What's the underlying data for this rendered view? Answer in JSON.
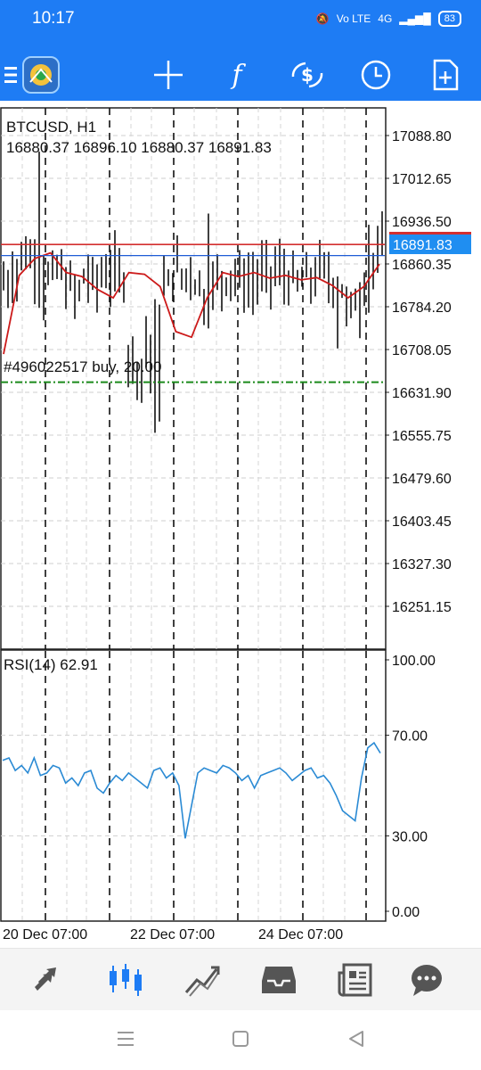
{
  "status": {
    "time": "10:17",
    "network": "Vo LTE",
    "signal": "4G",
    "battery": "83"
  },
  "toolbar": {
    "items": [
      {
        "icon": "menu-icon"
      },
      {
        "icon": "metatrader-logo"
      },
      {
        "icon": "crosshair-icon"
      },
      {
        "icon": "function-icon",
        "label": "f"
      },
      {
        "icon": "symbol-change-icon"
      },
      {
        "icon": "clock-icon"
      },
      {
        "icon": "add-file-icon"
      }
    ]
  },
  "chart": {
    "symbol_title": "BTCUSD, H1",
    "ohlc_line": "16880.37 16896.10 16880.37 16891.83",
    "current_price": "16891.83",
    "order_label": "#496022517 buy, 20.00",
    "price_ticks": [
      "17088.80",
      "17012.65",
      "16936.50",
      "16860.35",
      "16784.20",
      "16708.05",
      "16631.90",
      "16555.75",
      "16479.60",
      "16403.45",
      "16327.30",
      "16251.15"
    ],
    "rsi_title": "RSI(14) 62.91",
    "rsi_ticks": [
      "100.00",
      "70.00",
      "30.00",
      "0.00"
    ],
    "time_ticks": [
      "20 Dec 07:00",
      "22 Dec 07:00",
      "24 Dec 07:00"
    ],
    "colors": {
      "bid_line": "#d32f2f",
      "ask_line": "#1f5cd6",
      "ma_line": "#cc1a1a",
      "order_line": "#1b8a1b",
      "rsi_line": "#2a8ad4",
      "price_badge": "#1f8ef1"
    }
  },
  "chart_data": [
    {
      "type": "candlestick",
      "title": "BTCUSD, H1",
      "ylim": [
        16200,
        17120
      ],
      "y_ticks": [
        17088.8,
        17012.65,
        16936.5,
        16860.35,
        16784.2,
        16708.05,
        16631.9,
        16555.75,
        16479.6,
        16403.45,
        16327.3,
        16251.15
      ],
      "x_ticks": [
        "20 Dec 07:00",
        "22 Dec 07:00",
        "24 Dec 07:00"
      ],
      "series": [
        {
          "name": "",
          "type": "moving-average",
          "values": [
            16700,
            16840,
            16870,
            16880,
            16845,
            16838,
            16815,
            16800,
            16845,
            16842,
            16820,
            16740,
            16730,
            16800,
            16845,
            16838,
            16845,
            16835,
            16840,
            16832,
            16836,
            16822,
            16800,
            16820,
            16860
          ]
        }
      ],
      "horizontal_lines": {
        "bid": 16891.83,
        "ask": 16880,
        "order": 16650
      }
    },
    {
      "type": "line",
      "title": "RSI(14) 62.91",
      "ylim": [
        0,
        100
      ],
      "y_ticks": [
        100,
        70,
        30,
        0
      ],
      "levels": [
        70,
        30
      ],
      "series": [
        {
          "name": "RSI(14)",
          "values": [
            60,
            61,
            56,
            58,
            55,
            61,
            54,
            55,
            58,
            57,
            51,
            53,
            50,
            55,
            56,
            49,
            47,
            51,
            54,
            52,
            55,
            53,
            51,
            49,
            56,
            57,
            53,
            55,
            50,
            29,
            42,
            55,
            57,
            56,
            55,
            58,
            57,
            55,
            52,
            54,
            49,
            54,
            55,
            56,
            57,
            55,
            52,
            54,
            56,
            57,
            53,
            54,
            51,
            46,
            40,
            38,
            36,
            53,
            65,
            67,
            62.91
          ]
        }
      ]
    }
  ],
  "nav": {
    "items": [
      {
        "icon": "quotes-icon"
      },
      {
        "icon": "chart-icon",
        "active": true
      },
      {
        "icon": "trade-icon"
      },
      {
        "icon": "history-icon"
      },
      {
        "icon": "news-icon"
      },
      {
        "icon": "chat-icon"
      }
    ]
  }
}
